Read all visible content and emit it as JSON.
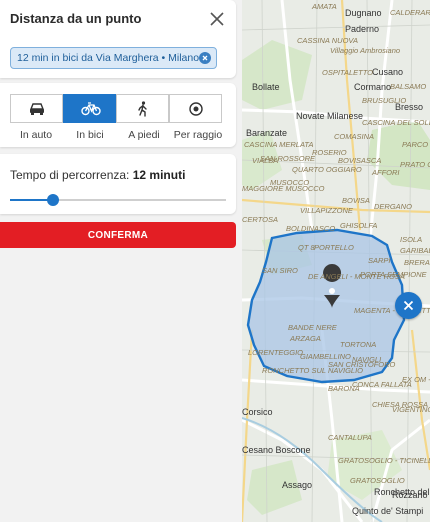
{
  "panel": {
    "title": "Distanza da un punto",
    "chip_label": "12 min in bici da Via Marghera • Milano"
  },
  "modes": [
    {
      "label": "In auto",
      "icon": "car-icon",
      "active": false
    },
    {
      "label": "In bici",
      "icon": "bicycle-icon",
      "active": true
    },
    {
      "label": "A piedi",
      "icon": "walking-icon",
      "active": false
    },
    {
      "label": "Per raggio",
      "icon": "radius-icon",
      "active": false
    }
  ],
  "time": {
    "label": "Tempo di percorrenza:",
    "value": "12 minuti",
    "slider_fraction": 0.2
  },
  "confirm_label": "CONFERMA",
  "colors": {
    "accent": "#1e75c8",
    "confirm": "#e31e24",
    "isochrone_fill": "#a9c6e6",
    "isochrone_stroke": "#1e75c8"
  },
  "map": {
    "towns": [
      "Dugnano",
      "Paderno",
      "Cusano",
      "Cormano",
      "Bollate",
      "Bresso",
      "Novate Milanese",
      "Baranzate",
      "Corsico",
      "Cesano Boscone",
      "Assago",
      "Rozzano",
      "Quinto de' Stampi",
      "Ronchetto delle Rane"
    ],
    "districts": [
      "AMATA",
      "CALDERARA",
      "CASSINA NUOVA",
      "Villaggio Ambrosiano",
      "OSPITALETTO",
      "BALSAMO",
      "BRUSUGLIO",
      "CASCINA DEL SOLE",
      "COMASINA",
      "PARCO NORD",
      "PRATO CENTENARO",
      "SAN ROSSORE",
      "CASCINA MERLATA",
      "QUARTO OGGIARO",
      "BOVISASCA",
      "AFFORI",
      "ROSERIO",
      "VIALBA",
      "MAGGIORE MUSOCCO",
      "MUSOCCO",
      "BOVISA",
      "DERGANO",
      "VILLAPIZZONE",
      "BOLDINASCO",
      "GHISOLFA",
      "CERTOSA",
      "PORTELLO",
      "QT 8",
      "SARPI",
      "SAN SIRO",
      "DE ANGELI - MONTE ROSA",
      "PORTA SEMPIONE",
      "MAGENTA - SAN VITTORE",
      "BANDE NERE",
      "ARZAGA",
      "TORTONA",
      "GIAMBELLINO",
      "SAN CRISTOFORO",
      "LORENTEGGIO",
      "RONCHETTO SUL NAVIGLIO",
      "BARONA",
      "CANTALUPA",
      "GRATOSOGLIO - TICINELLO",
      "GRATOSOGLIO",
      "CONCA FALLATA",
      "CHIESA ROSSA",
      "ISOLA",
      "GARIBALDI",
      "BRERA",
      "NAVIGLI",
      "EX OM - MORIVIONE",
      "VIGENTINO"
    ]
  }
}
